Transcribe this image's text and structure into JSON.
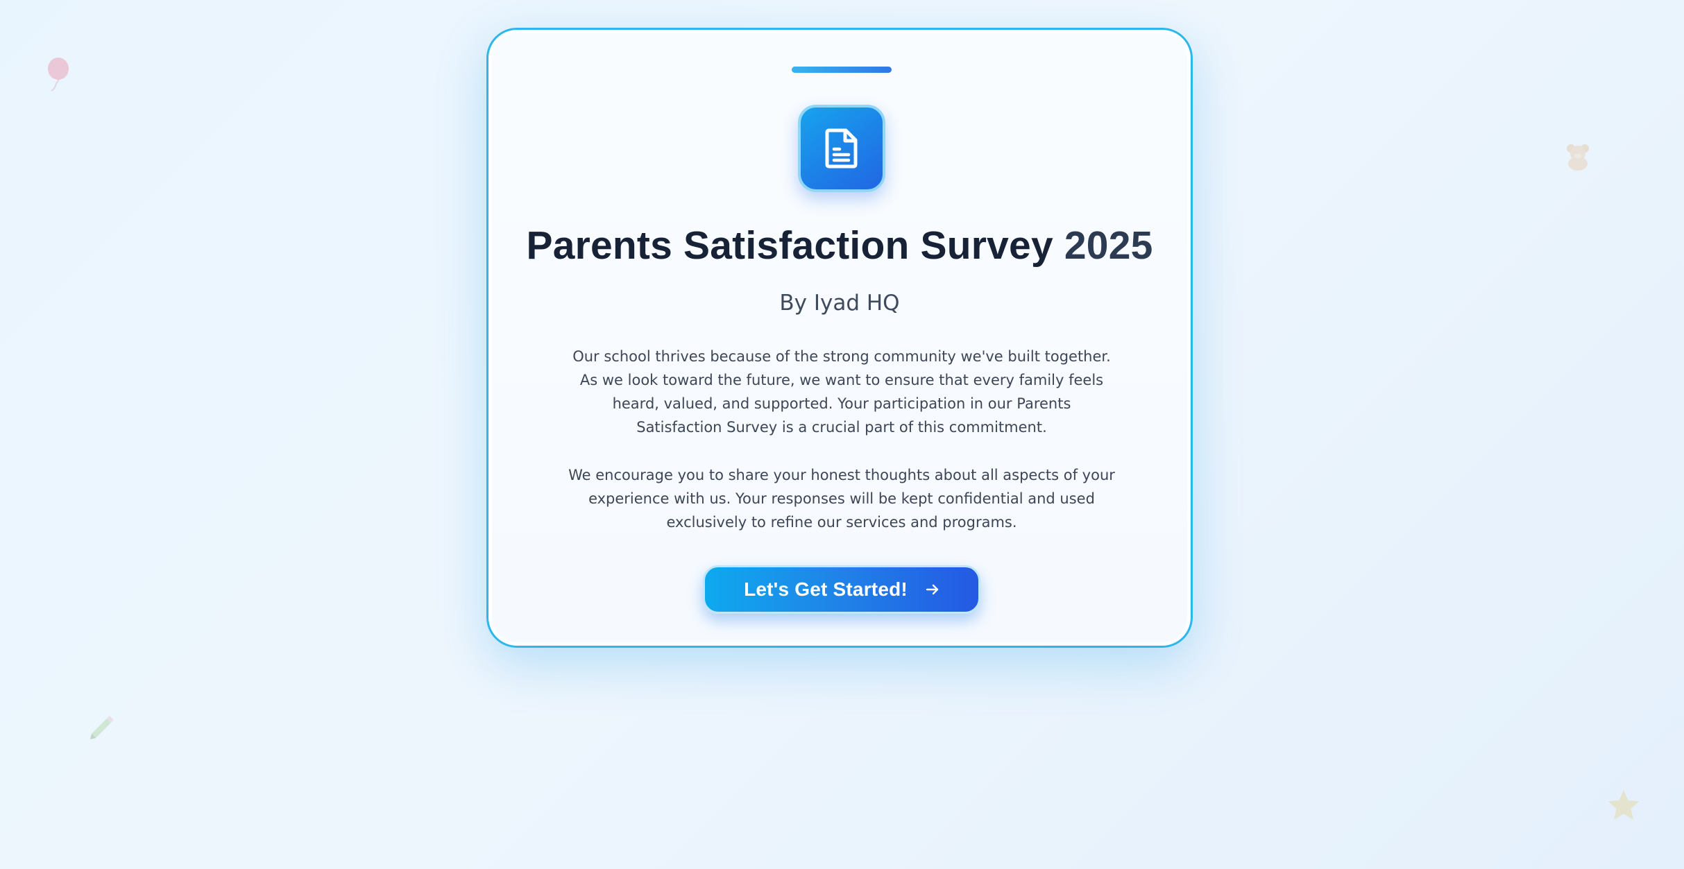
{
  "survey": {
    "title": "Parents Satisfaction Survey",
    "year": "2025",
    "author": "By Iyad HQ",
    "intro_paragraphs": [
      "Our school thrives because of the strong community we've built together. As we look toward the future, we want to ensure that every family feels heard, valued, and supported. Your participation in our Parents Satisfaction Survey is a crucial part of this commitment.",
      "We encourage you to share your honest thoughts about all aspects of your experience with us. Your responses will be kept confidential and used exclusively to refine our services and programs."
    ],
    "start_button_label": "Let's Get Started!"
  },
  "icons": {
    "header": "document-icon",
    "button": "arrow-right-icon",
    "decorations": [
      "balloon-icon",
      "teddy-bear-icon",
      "pencil-icon",
      "star-icon"
    ]
  },
  "colors": {
    "accent_start": "#0ea9ef",
    "accent_end": "#2459e4",
    "card_border": "#2bb7ea",
    "title_text": "#182236",
    "body_text": "#3d4656"
  }
}
